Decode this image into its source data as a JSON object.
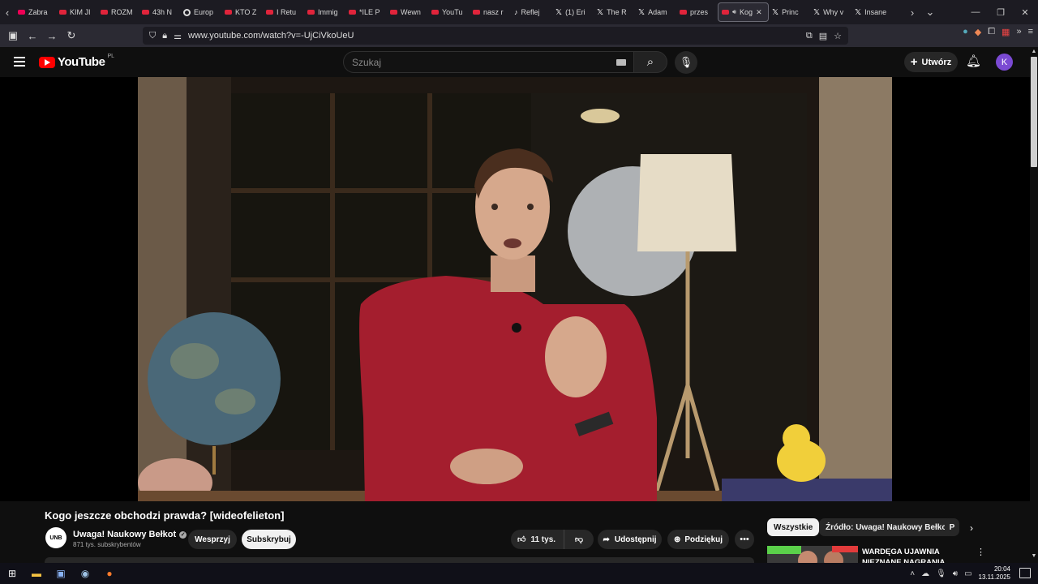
{
  "browser": {
    "tabs": [
      {
        "label": "Zabra",
        "icon": "firefox-pocket"
      },
      {
        "label": "KIM JI",
        "icon": "youtube"
      },
      {
        "label": "ROZM",
        "icon": "youtube"
      },
      {
        "label": "43h N",
        "icon": "youtube"
      },
      {
        "label": "Europ",
        "icon": "globe"
      },
      {
        "label": "KTO Z",
        "icon": "youtube"
      },
      {
        "label": "I Retu",
        "icon": "youtube"
      },
      {
        "label": "Immig",
        "icon": "youtube"
      },
      {
        "label": "*ILE P",
        "icon": "youtube"
      },
      {
        "label": "Wewn",
        "icon": "youtube"
      },
      {
        "label": "YouTu",
        "icon": "youtube"
      },
      {
        "label": "nasz r",
        "icon": "youtube"
      },
      {
        "label": "Reflej",
        "icon": "tiktok"
      },
      {
        "label": "(1) Eri",
        "icon": "x"
      },
      {
        "label": "The R",
        "icon": "x"
      },
      {
        "label": "Adam",
        "icon": "x"
      },
      {
        "label": "przes",
        "icon": "youtube"
      },
      {
        "label": "Kog",
        "icon": "youtube",
        "active": true
      },
      {
        "label": "Princ",
        "icon": "x"
      },
      {
        "label": "Why v",
        "icon": "x"
      },
      {
        "label": "Insane",
        "icon": "x"
      }
    ],
    "url": "www.youtube.com/watch?v=-UjCiVkoUeU"
  },
  "youtube": {
    "logo_text": "YouTube",
    "country_code": "PL",
    "search_placeholder": "Szukaj",
    "create_label": "Utwórz",
    "avatar_letter": "K"
  },
  "video": {
    "title": "Kogo jeszcze obchodzi prawda? [wideofelieton]",
    "channel_name": "Uwaga! Naukowy Bełkot",
    "channel_avatar_text": "UNB",
    "subscribers": "871 tys. subskrybentów",
    "support_label": "Wesprzyj",
    "subscribe_label": "Subskrybuj",
    "likes": "11 tys.",
    "share_label": "Udostępnij",
    "thanks_label": "Podziękuj"
  },
  "sidebar": {
    "chips": [
      "Wszystkie",
      "Źródło: Uwaga! Naukowy Bełkot",
      "P"
    ],
    "first_video_title": "WARDĘGA UJAWNIA NIEZNANE NAGRANIA BOXDELA"
  },
  "taskbar": {
    "time": "20:04",
    "date": "13.11.2025"
  }
}
